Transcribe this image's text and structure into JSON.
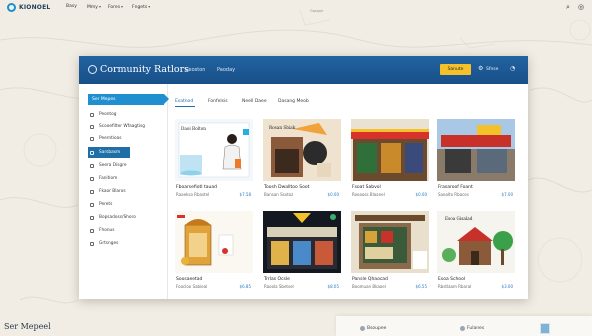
{
  "site": {
    "logo_text": "KIONOEL",
    "nav": [
      {
        "label": "Basy",
        "has_caret": false
      },
      {
        "label": "Mmy",
        "has_caret": true
      },
      {
        "label": "Fores",
        "has_caret": true
      },
      {
        "label": "Fngets",
        "has_caret": true
      }
    ],
    "top_center_caption": "Gasqoir"
  },
  "window": {
    "title": "Cormunity Ratlors",
    "header_links": [
      "Ceoston",
      "Paoday"
    ],
    "cta_button": "Sanute",
    "header_right_text": "Sfnse",
    "header_icons": [
      "gear-icon",
      "user-icon"
    ]
  },
  "sidebar": {
    "active": "Ser Mepes",
    "items": [
      {
        "label": "Peontog",
        "icon": "home-icon"
      },
      {
        "label": "Scooefilter Wfaagtisg",
        "icon": "filter-icon"
      },
      {
        "label": "Peerntioas",
        "icon": "map-icon"
      },
      {
        "label": "Sarsbasm",
        "icon": "store-icon",
        "highlighted": true
      },
      {
        "label": "Seera Disgre",
        "icon": "tag-icon"
      },
      {
        "label": "Fanitiom",
        "icon": "list-icon"
      },
      {
        "label": "Fkaor Blaros",
        "icon": "box-icon"
      },
      {
        "label": "Perets",
        "icon": "doc-icon"
      },
      {
        "label": "Bopsadoss/Shoro",
        "icon": "share-icon"
      },
      {
        "label": "Fhonus",
        "icon": "phone-icon"
      },
      {
        "label": "Grtsnges",
        "icon": "settings-icon"
      }
    ]
  },
  "tabs": [
    {
      "label": "Esatnod",
      "active": true
    },
    {
      "label": "Fonfelsis",
      "active": false
    },
    {
      "label": "Neell Daee",
      "active": false
    },
    {
      "label": "Dasang Meob",
      "active": false
    }
  ],
  "cards": [
    {
      "title": "Fboarsefiotl tauad",
      "subtitle": "Raaekso Rbastel",
      "price": "$7.58",
      "art": "illustration",
      "caption": "Daoi Rolton"
    },
    {
      "title": "Toosh Dwalltoo Soot",
      "subtitle": "Bansan Ssxtoz",
      "price": "$0.00",
      "art": "shopfront-sign",
      "caption": "Rosan Sbiak"
    },
    {
      "title": "Fsoat Sabvol",
      "subtitle": "Roeaoss Blaanel",
      "price": "$0.00",
      "art": "market-stall",
      "caption": ""
    },
    {
      "title": "Frasaroof Foant",
      "subtitle": "Saealto Rbaces",
      "price": "$7.00",
      "art": "storefront",
      "caption": ""
    },
    {
      "title": "Soosaeetad",
      "subtitle": "Foocloo Sabieal",
      "price": "$6.85",
      "art": "kiosk",
      "caption": ""
    },
    {
      "title": "Trrlas Ocsle",
      "subtitle": "Raoola Sbetsel",
      "price": "$8.05",
      "art": "night-shop",
      "caption": ""
    },
    {
      "title": "Pansle Qhaocad",
      "subtitle": "Boomuan Bkaoel",
      "price": "$6.55",
      "art": "grocery",
      "caption": ""
    },
    {
      "title": "Esoa School",
      "subtitle": "Rbstlaam Rbaral",
      "price": "$3.00",
      "art": "school-house",
      "caption": "Esoa Gisalad"
    }
  ],
  "footer": {
    "title": "Ser Mepeel",
    "items": [
      "Bsoupee",
      "Fulanes"
    ],
    "thumb_icon": "photo-icon"
  },
  "colors": {
    "header_blue": "#1f5b98",
    "accent_blue": "#1f8fd0",
    "cta_yellow": "#f4c12a",
    "price_blue": "#2a7ac0"
  }
}
